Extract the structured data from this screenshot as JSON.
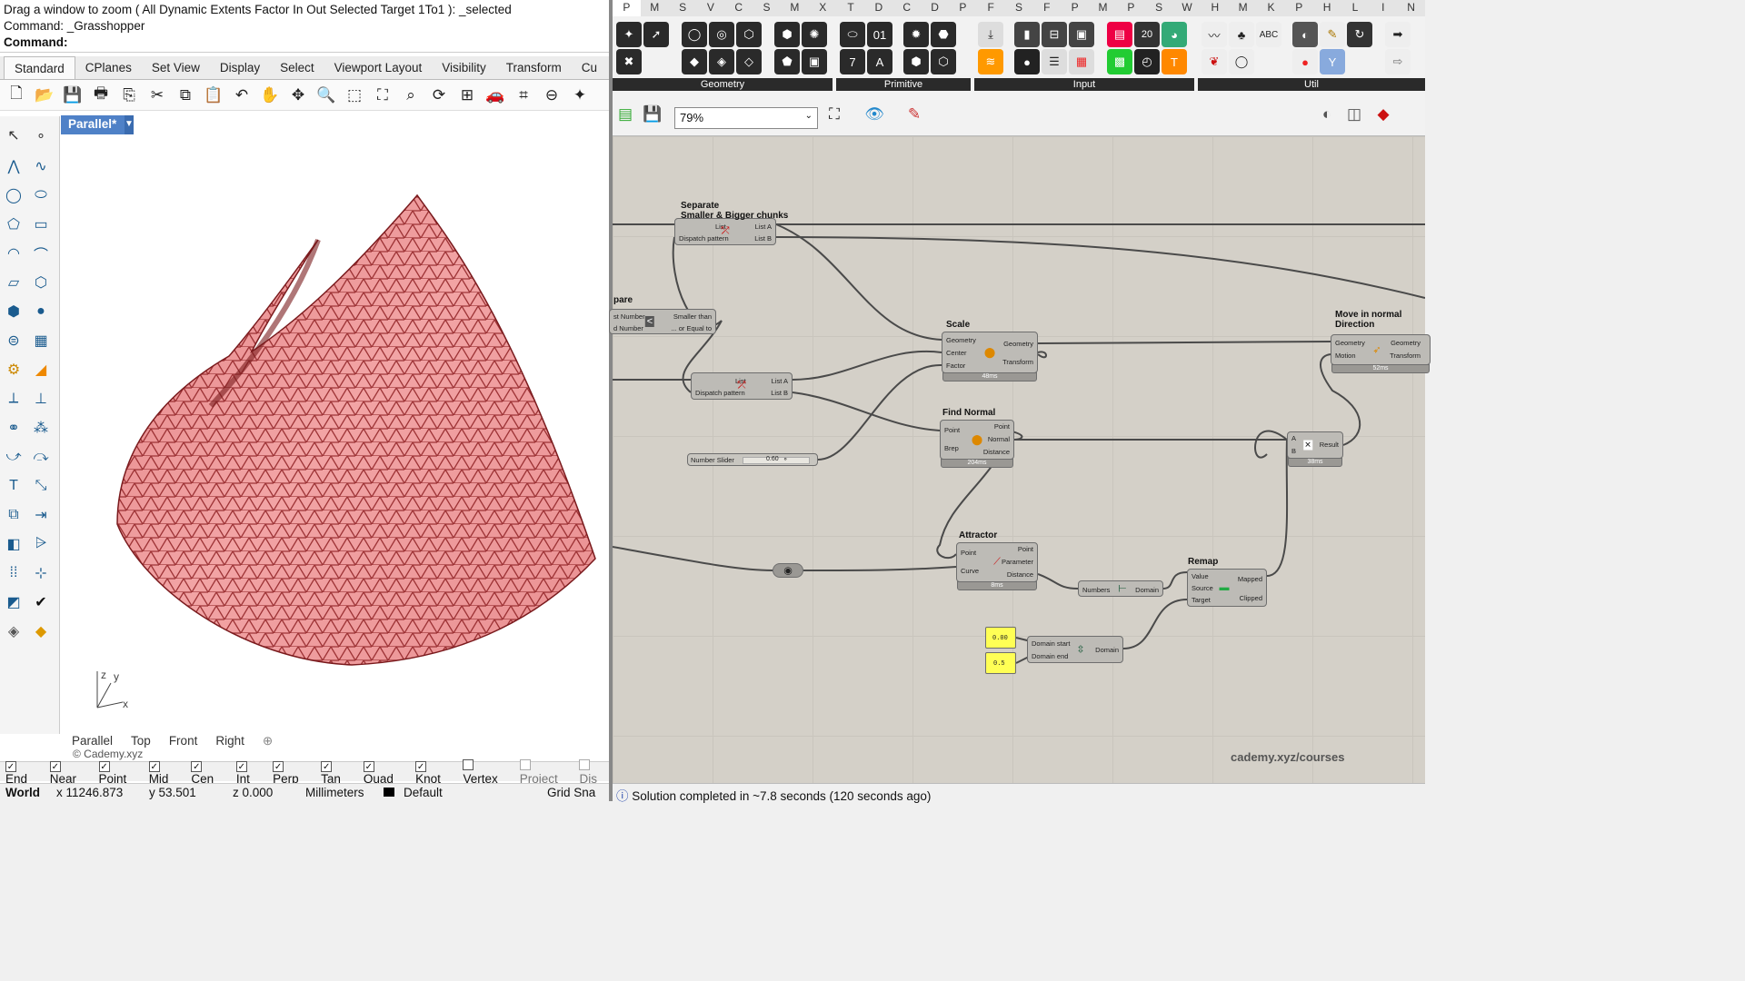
{
  "command": {
    "line1": "Drag a window to zoom ( All  Dynamic  Extents  Factor  In  Out  Selected  Target  1To1 ): _selected",
    "line2": "Command: _Grasshopper",
    "prompt": "Command:"
  },
  "rhino_tabs": [
    "Standard",
    "CPlanes",
    "Set View",
    "Display",
    "Select",
    "Viewport Layout",
    "Visibility",
    "Transform",
    "Cu"
  ],
  "viewport": {
    "name": "Parallel*",
    "axis_y": "y",
    "axis_x": "x",
    "axis_z": "z",
    "tabs": [
      "Parallel",
      "Top",
      "Front",
      "Right"
    ],
    "copyright": "© Cademy.xyz"
  },
  "osnaps": [
    {
      "label": "End",
      "checked": true
    },
    {
      "label": "Near",
      "checked": true
    },
    {
      "label": "Point",
      "checked": true
    },
    {
      "label": "Mid",
      "checked": true
    },
    {
      "label": "Cen",
      "checked": true
    },
    {
      "label": "Int",
      "checked": true
    },
    {
      "label": "Perp",
      "checked": true
    },
    {
      "label": "Tan",
      "checked": true
    },
    {
      "label": "Quad",
      "checked": true
    },
    {
      "label": "Knot",
      "checked": true
    },
    {
      "label": "Vertex",
      "checked": false
    },
    {
      "label": "Project",
      "checked": false
    },
    {
      "label": "Dis",
      "checked": false
    }
  ],
  "status": {
    "world": "World",
    "x": "x 11246.873",
    "y": "y 53.501",
    "z": "z 0.000",
    "units": "Millimeters",
    "layer": "Default",
    "grid": "Grid Sna"
  },
  "gh_tabs": [
    "P",
    "M",
    "S",
    "V",
    "C",
    "S",
    "M",
    "X",
    "T",
    "D",
    "C",
    "D",
    "P",
    "F",
    "S",
    "F",
    "P",
    "M",
    "P",
    "S",
    "W",
    "H",
    "M",
    "K",
    "P",
    "H",
    "L",
    "I",
    "N"
  ],
  "component_groups": [
    "Geometry",
    "Primitive",
    "Input",
    "Util"
  ],
  "gh_zoom": "79%",
  "nodes": {
    "separate": {
      "title": "Separate\nSmaller & Bigger chunks",
      "in": [
        "List",
        "Dispatch pattern"
      ],
      "out": [
        "List A",
        "List B"
      ]
    },
    "compare": {
      "title": "pare",
      "in": [
        "st Number",
        "d Number"
      ],
      "out": [
        "Smaller than",
        "... or Equal to"
      ]
    },
    "dispatch2": {
      "in": [
        "List",
        "Dispatch pattern"
      ],
      "out": [
        "List A",
        "List B"
      ]
    },
    "slider": {
      "label": "Number Slider",
      "value": "0.60"
    },
    "scale": {
      "title": "Scale",
      "in": [
        "Geometry",
        "Center",
        "Factor"
      ],
      "out": [
        "Geometry",
        "Transform"
      ],
      "time": "48ms"
    },
    "find_normal": {
      "title": "Find Normal",
      "in": [
        "Point",
        "Brep"
      ],
      "out": [
        "Point",
        "Normal",
        "Distance"
      ],
      "time": "204ms"
    },
    "attractor": {
      "title": "Attractor",
      "in": [
        "Point",
        "Curve"
      ],
      "out": [
        "Point",
        "Parameter",
        "Distance"
      ],
      "time": "8ms"
    },
    "multiply": {
      "in": [
        "A",
        "B"
      ],
      "out": [
        "Result"
      ],
      "time": "38ms"
    },
    "move": {
      "title": "Move in normal\nDirection",
      "in": [
        "Geometry",
        "Motion"
      ],
      "out": [
        "Geometry",
        "Transform"
      ],
      "time": "52ms"
    },
    "bounds": {
      "in": [
        "Numbers"
      ],
      "out": [
        "Domain"
      ]
    },
    "remap": {
      "title": "Remap",
      "in": [
        "Value",
        "Source",
        "Target"
      ],
      "out": [
        "Mapped",
        "Clipped"
      ]
    },
    "panel1": {
      "value": "0.00"
    },
    "panel2": {
      "value": "0.5"
    },
    "domain": {
      "in": [
        "Domain start",
        "Domain end"
      ],
      "out": [
        "Domain"
      ]
    }
  },
  "watermark": "cademy.xyz/courses",
  "gh_status": "Solution completed in ~7.8 seconds (120 seconds ago)",
  "colors": {
    "surface": "#c0393b",
    "viewport_tab": "#4f81c7",
    "gh_canvas": "#d4d0c8",
    "panel": "#ffff55"
  }
}
